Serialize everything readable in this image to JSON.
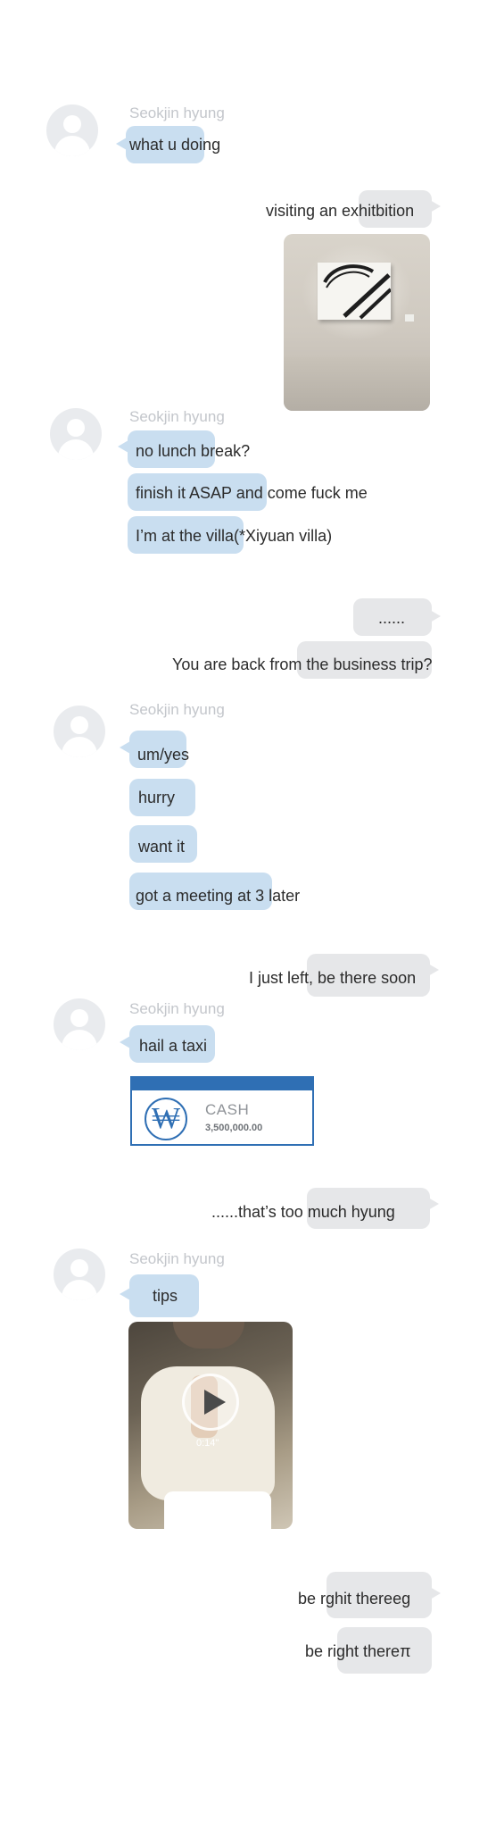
{
  "sender_name": "Seokjin hyung",
  "messages": {
    "m1": "what u doing",
    "m2": "visiting an exhitbition",
    "m3": "no lunch break?",
    "m4": "finish it ASAP and come fuck me",
    "m5": "I’m at the villa(*Xiyuan villa)",
    "m6": "......",
    "m7": "You are back from the business trip?",
    "m8": "um/yes",
    "m9": "hurry",
    "m10": "want it",
    "m11": "got a meeting at 3 later",
    "m12": "I just left, be there soon",
    "m13": "hail a taxi",
    "m14": "......that’s too much hyung",
    "m15": "tips",
    "m16": "be rghit thereeg",
    "m17": "be right thereπ"
  },
  "cash_card": {
    "symbol": "₩",
    "label": "CASH",
    "amount": "3,500,000.00"
  },
  "video": {
    "duration": "0:14\""
  },
  "colors": {
    "incoming_bubble": "#c9def0",
    "outgoing_bubble": "#e6e7e9",
    "cash_blue": "#2f6fb4",
    "sender_name": "#c3c6cb"
  },
  "icons": [
    "avatar-placeholder-icon",
    "play-icon",
    "won-icon"
  ]
}
